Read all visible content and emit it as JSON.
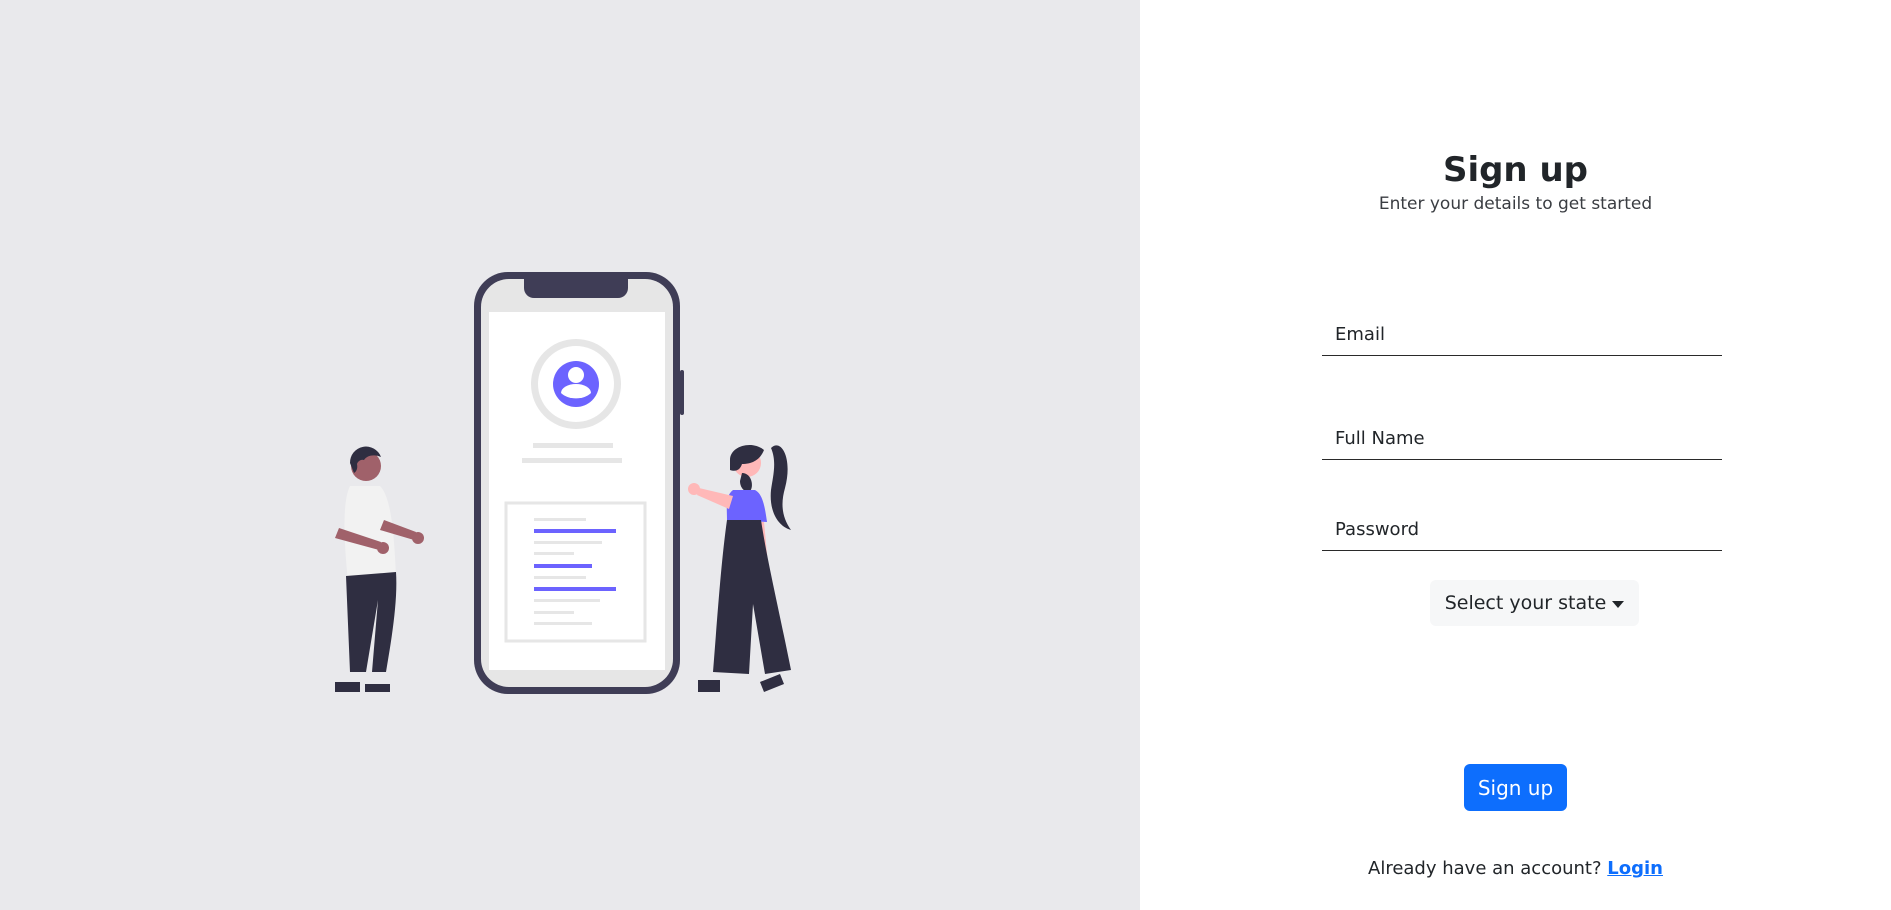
{
  "header": {
    "title": "Sign up",
    "subtitle": "Enter your details to get started"
  },
  "form": {
    "email_placeholder": "Email",
    "email_value": "",
    "fullname_placeholder": "Full Name",
    "fullname_value": "",
    "password_placeholder": "Password",
    "password_value": "",
    "state_dropdown_label": "Select your state",
    "submit_label": "Sign up"
  },
  "footer": {
    "prompt": "Already have an account?",
    "login_label": "Login"
  },
  "illustration": {
    "description_icon": "signup-illustration-icon"
  },
  "colors": {
    "left_panel_bg": "#e9e9ec",
    "accent": "#0d6efd",
    "illustration_purple": "#6c63ff",
    "illustration_dark": "#3f3d56"
  }
}
